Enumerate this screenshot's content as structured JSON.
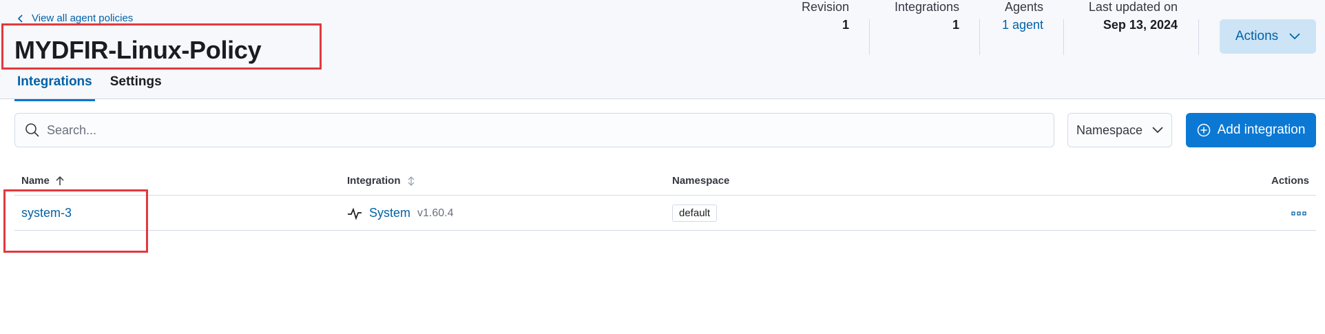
{
  "header": {
    "back_link": "View all agent policies",
    "title": "MYDFIR-Linux-Policy",
    "stats": {
      "revision_label": "Revision",
      "revision_value": "1",
      "integrations_label": "Integrations",
      "integrations_value": "1",
      "agents_label": "Agents",
      "agents_value": "1 agent",
      "updated_label": "Last updated on",
      "updated_value": "Sep 13, 2024"
    },
    "actions_label": "Actions"
  },
  "tabs": [
    {
      "label": "Integrations",
      "active": true
    },
    {
      "label": "Settings",
      "active": false
    }
  ],
  "toolbar": {
    "search_placeholder": "Search...",
    "namespace_label": "Namespace",
    "add_label": "Add integration"
  },
  "table": {
    "columns": [
      "Name",
      "Integration",
      "Namespace",
      "Actions"
    ],
    "rows": [
      {
        "name": "system-3",
        "integration": "System",
        "version": "v1.60.4",
        "namespace": "default"
      }
    ]
  },
  "colors": {
    "accent": "#0b78d4",
    "link": "#0061a6",
    "highlight": "#e0393e"
  }
}
